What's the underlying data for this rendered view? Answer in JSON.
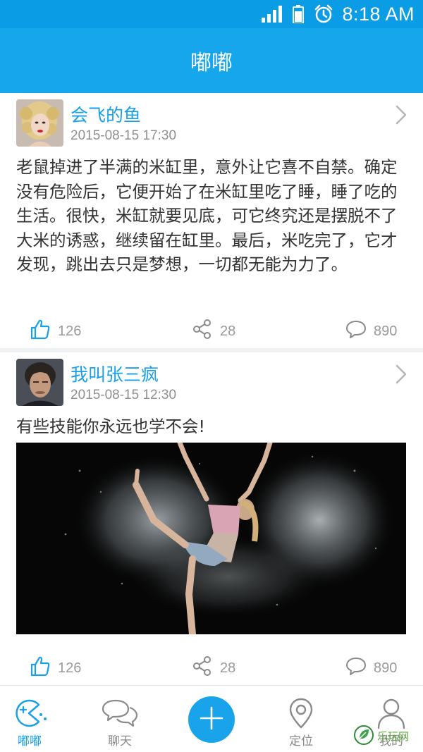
{
  "status_bar": {
    "time": "8:18 AM",
    "icons": [
      "signal-icon",
      "battery-icon",
      "alarm-icon"
    ]
  },
  "header": {
    "title": "嘟嘟"
  },
  "posts": [
    {
      "avatar": "avatar-blonde-woman",
      "username": "会飞的鱼",
      "timestamp": "2015-08-15 17:30",
      "content": "老鼠掉进了半满的米缸里，意外让它喜不自禁。确定没有危险后，它便开始了在米缸里吃了睡，睡了吃的生活。很快，米缸就要见底，可它终究还是摆脱不了大米的诱惑，继续留在缸里。最后，米吃完了，它才发现，跳出去只是梦想，一切都无能为力了。",
      "likes": "126",
      "shares": "28",
      "comments": "890"
    },
    {
      "avatar": "avatar-dark-haired-man",
      "username": "我叫张三疯",
      "timestamp": "2015-08-15 12:30",
      "content": "有些技能你永远也学不会!",
      "image": "dancer-in-powder-photo",
      "likes": "126",
      "shares": "28",
      "comments": "890"
    }
  ],
  "bottom_nav": [
    {
      "label": "嘟嘟",
      "icon": "pacman-icon",
      "active": true
    },
    {
      "label": "聊天",
      "icon": "chat-bubbles-icon",
      "active": false
    },
    {
      "label": "",
      "icon": "plus-icon",
      "active": false
    },
    {
      "label": "定位",
      "icon": "location-pin-icon",
      "active": false
    },
    {
      "label": "我的",
      "icon": "person-icon",
      "active": false
    }
  ],
  "watermark": {
    "text": "乐玩网"
  },
  "colors": {
    "header": "#16a6ec",
    "status_bar": "#0a9de6",
    "accent": "#1aa0e6",
    "divider": "#eef0f1"
  }
}
